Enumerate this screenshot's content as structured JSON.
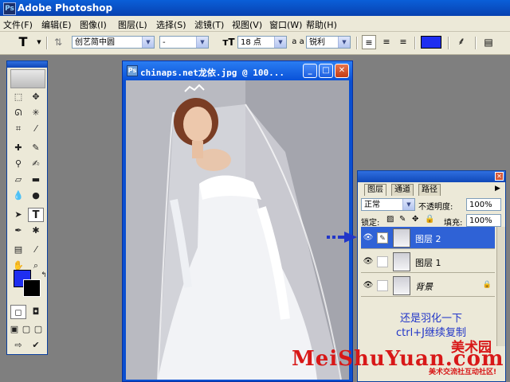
{
  "app": {
    "title": "Adobe Photoshop"
  },
  "menu": [
    "文件(F)",
    "编辑(E)",
    "图像(I)",
    "图层(L)",
    "选择(S)",
    "滤镜(T)",
    "视图(V)",
    "窗口(W)",
    "帮助(H)"
  ],
  "options": {
    "tool_glyph": "T",
    "font_family": "创艺简中圆",
    "font_style": "-",
    "font_size": "18 点",
    "aa_label": "a a",
    "aa_mode": "锐利",
    "text_color": "#1e2ef0"
  },
  "document": {
    "title": "chinaps.net龙依.jpg @ 100..."
  },
  "layers_panel": {
    "tabs": [
      "图层",
      "通道",
      "路径"
    ],
    "blend_mode": "正常",
    "opacity_label": "不透明度:",
    "opacity_value": "100%",
    "lock_label": "锁定:",
    "fill_label": "填充:",
    "fill_value": "100%",
    "layers": [
      {
        "name": "图层 2",
        "selected": true
      },
      {
        "name": "图层 1",
        "selected": false
      },
      {
        "name": "背景",
        "selected": false
      }
    ]
  },
  "note": {
    "line1": "还是羽化一下",
    "line2": "ctrl+J继续复制"
  },
  "watermark": {
    "text": "MeiShuYuan.com",
    "cn": "美术园",
    "sub": "美术交流社互动社区!"
  }
}
